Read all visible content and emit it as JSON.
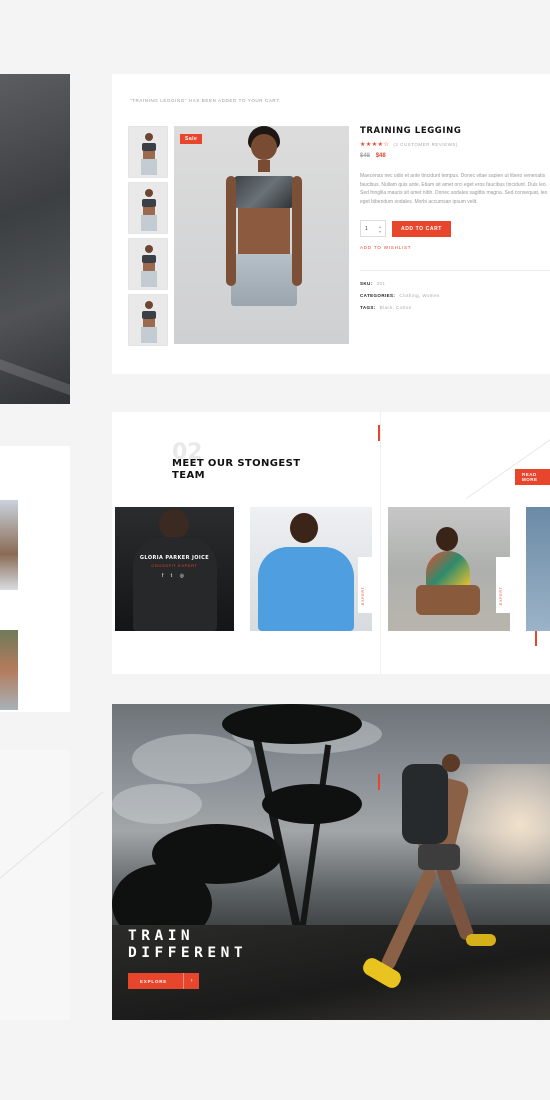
{
  "product": {
    "notice": "“Training legging” has been added to your cart.",
    "badge": "Sale",
    "title": "Training Legging",
    "stars": "★★★★☆",
    "reviews": "(2 customer reviews)",
    "old_price": "$48",
    "new_price": "$48",
    "description": "Maecenas nec odio et ante tincidunt tempus. Donec vitae sapien ut libero venenatis faucibus. Nullam quis ante. Etiam sit amet orci eget eros faucibus tincidunt. Duis leo. Sed fringilla mauris sit amet nibh. Donec sodales sagittis magna. Sed consequat, leo eget bibendum sodales. Morbi accumsan ipsum velit.",
    "qty": "1",
    "add_to_cart": "Add to cart",
    "wishlist": "Add to wishlist",
    "meta": {
      "sku_label": "SKU:",
      "sku": "201",
      "categories_label": "Categories:",
      "categories": "Clothing, Women",
      "tags_label": "Tags:",
      "tags": "Black, Cotton"
    }
  },
  "team": {
    "number": "02",
    "title": "Meet our stongest team",
    "read_more": "Read more",
    "members": [
      {
        "name": "Gloria Parker Joice",
        "role": "Crossfit Expert",
        "social": "f t ◎"
      },
      {
        "side_label": "Expert"
      },
      {
        "side_label": "Expert"
      }
    ]
  },
  "hero": {
    "title_line1": "Train",
    "title_line2": "Different",
    "button": "Explore",
    "button_arrow": "›"
  },
  "colors": {
    "accent": "#e8462c",
    "background": "#f4f4f5"
  }
}
